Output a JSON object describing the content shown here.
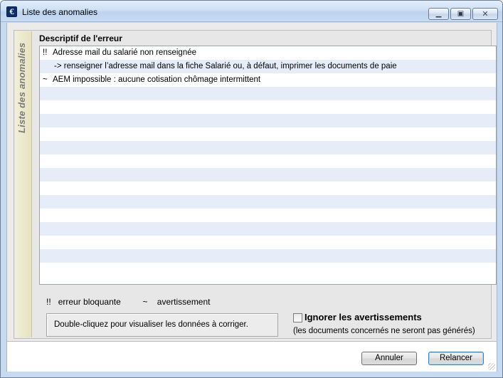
{
  "window": {
    "title": "Liste des anomalies",
    "icon_glyph": "€",
    "controls": {
      "minimize": "▁",
      "maximize": "▣",
      "close": "✕"
    }
  },
  "side_tab": {
    "label": "Liste des anomalies"
  },
  "list": {
    "header": "Descriptif de l'erreur",
    "rows": [
      {
        "symbol": "!!",
        "text": "Adresse mail du salarié non renseignée"
      },
      {
        "symbol": "",
        "text": "-> renseigner l’adresse mail dans la fiche Salarié ou, à défaut, imprimer les documents de paie"
      },
      {
        "symbol": "~",
        "text": "AEM impossible : aucune cotisation chômage intermittent"
      },
      {
        "symbol": "",
        "text": ""
      },
      {
        "symbol": "",
        "text": ""
      },
      {
        "symbol": "",
        "text": ""
      },
      {
        "symbol": "",
        "text": ""
      },
      {
        "symbol": "",
        "text": ""
      },
      {
        "symbol": "",
        "text": ""
      },
      {
        "symbol": "",
        "text": ""
      },
      {
        "symbol": "",
        "text": ""
      },
      {
        "symbol": "",
        "text": ""
      },
      {
        "symbol": "",
        "text": ""
      },
      {
        "symbol": "",
        "text": ""
      },
      {
        "symbol": "",
        "text": ""
      },
      {
        "symbol": "",
        "text": ""
      },
      {
        "symbol": "",
        "text": ""
      }
    ]
  },
  "legend": {
    "blocking_symbol": "!!",
    "blocking_label": "erreur bloquante",
    "warning_symbol": "~",
    "warning_label": "avertissement"
  },
  "hint": "Double-cliquez pour visualiser les données à corriger.",
  "ignore_warnings": {
    "label": "Ignorer les avertissements",
    "note": "(les documents concernés ne seront pas générés)",
    "checked": false
  },
  "buttons": {
    "cancel": "Annuler",
    "retry": "Relancer"
  }
}
